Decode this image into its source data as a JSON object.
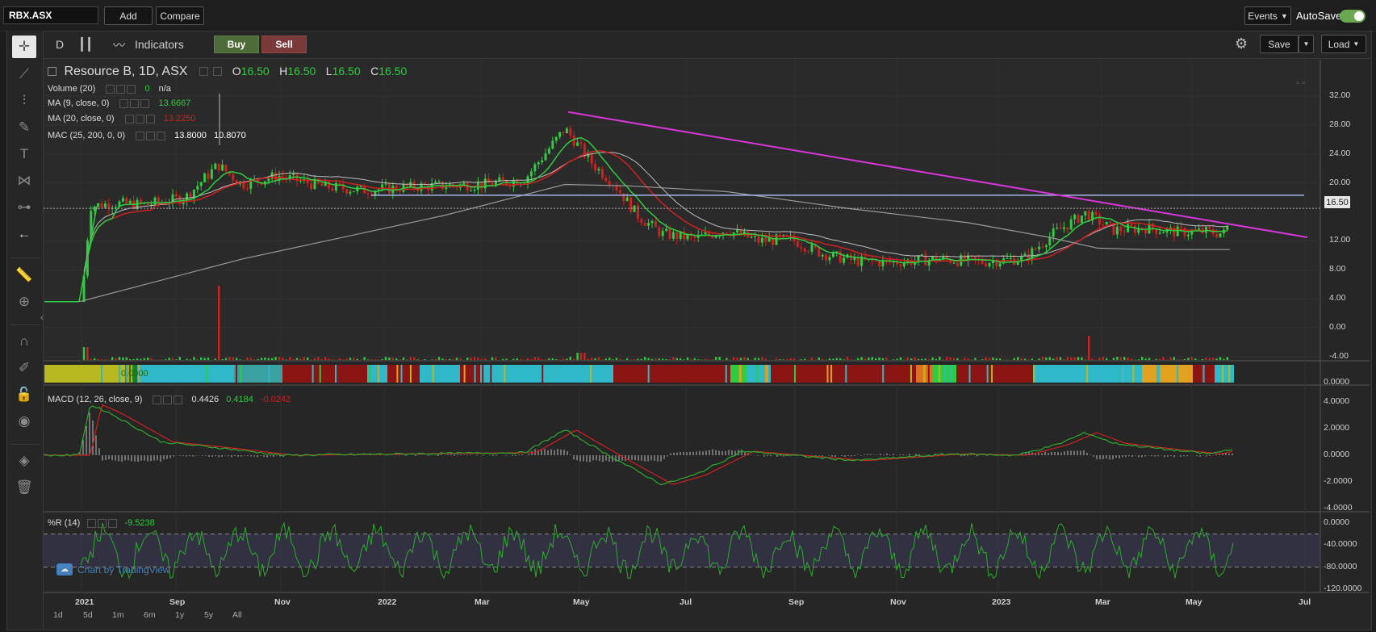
{
  "topbar": {
    "symbol": "RBX.ASX",
    "add_label": "Add",
    "compare_label": "Compare",
    "events_label": "Events",
    "autosave_label": "AutoSave"
  },
  "toolbar": {
    "interval": "D",
    "indicators_label": "Indicators",
    "buy_label": "Buy",
    "sell_label": "Sell",
    "save_label": "Save",
    "load_label": "Load"
  },
  "legend": {
    "title": "Resource B, 1D, ASX",
    "o_label": "O",
    "o_value": "16.50",
    "h_label": "H",
    "h_value": "16.50",
    "l_label": "L",
    "l_value": "16.50",
    "c_label": "C",
    "c_value": "16.50",
    "volume_label": "Volume (20)",
    "volume_v1": "0",
    "volume_v2": "n/a",
    "ma9_label": "MA (9, close, 0)",
    "ma9_value": "13.6667",
    "ma20_label": "MA (20, close, 0)",
    "ma20_value": "13.2250",
    "mac_label": "MAC (25, 200, 0, 0)",
    "mac_v1": "13.8000",
    "mac_v2": "10.8070",
    "macd_label": "MACD (12, 26, close, 9)",
    "macd_v1": "0.4426",
    "macd_v2": "0.4184",
    "macd_v3": "-0.0242",
    "wr_label": "%R (14)",
    "wr_value": "-9.5238",
    "band_value": "0.0000"
  },
  "colors": {
    "up": "#2ecc40",
    "down": "#d02020",
    "trendline": "#d936d9",
    "resistance": "#a8b8e8",
    "mac_long": "#9a9a9a",
    "accent_green": "#6aa84f"
  },
  "price_axis": [
    "32.00",
    "28.00",
    "24.00",
    "20.00",
    "16.50",
    "12.00",
    "8.00",
    "4.00",
    "0.00",
    "-4.00"
  ],
  "band_axis": "0.0000",
  "macd_axis": [
    "4.0000",
    "2.0000",
    "0.0000",
    "-2.0000",
    "-4.0000"
  ],
  "wr_axis": [
    "0.0000",
    "-40.0000",
    "-80.0000",
    "-120.0000"
  ],
  "time_axis": [
    "2021",
    "Sep",
    "Nov",
    "2022",
    "Mar",
    "May",
    "Jul",
    "Sep",
    "Nov",
    "2023",
    "Mar",
    "May",
    "Jul"
  ],
  "ranges": [
    "1d",
    "5d",
    "1m",
    "6m",
    "1y",
    "5y",
    "All"
  ],
  "attribution": "Chart by TradingView",
  "last_price": "16.50",
  "icons": {
    "crosshair": "crosshair-icon",
    "trendline": "trendline-icon",
    "fib": "fib-icon",
    "brush": "brush-icon",
    "text": "text-icon",
    "pattern": "pattern-icon",
    "prediction": "prediction-icon",
    "back": "back-arrow-icon",
    "measure": "ruler-icon",
    "zoom": "zoom-icon",
    "magnet": "magnet-icon",
    "lockdraw": "pencil-lock-icon",
    "lock": "lock-icon",
    "eye": "eye-icon",
    "layers": "layers-icon",
    "trash": "trash-icon",
    "gear": "gear-icon",
    "candles": "candles-icon",
    "indicator": "indicator-icon"
  }
}
